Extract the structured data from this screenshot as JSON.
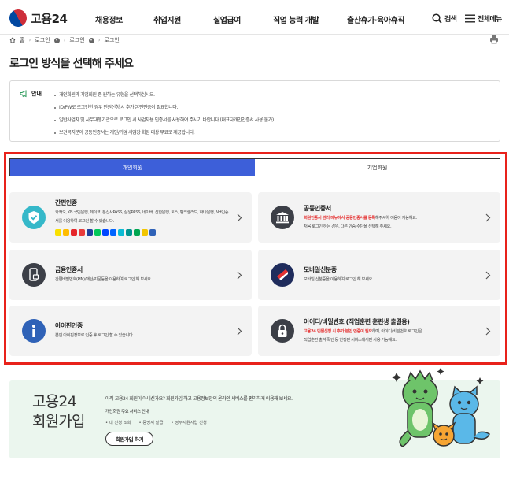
{
  "header": {
    "logo_text": "고용24",
    "nav": [
      "채용정보",
      "취업지원",
      "실업급여",
      "직업 능력 개발",
      "출산휴가·육아휴직"
    ],
    "search_label": "검색",
    "menu_label": "전체메뉴"
  },
  "breadcrumb": [
    "홈",
    "로그인",
    "로그인",
    "로그인"
  ],
  "page_title": "로그인 방식을 선택해 주세요",
  "notice": {
    "label": "안내",
    "items": [
      "개인회원과 기업회원 중 원하는 유형을 선택하십시오.",
      "ID/PW로 로그인한 경우 민원신청 시 추가 본인인증이 필요합니다.",
      "일반사업자 및 사무대행기관으로 로그인 시 사업자용 인증서를 사용하여 주시기 바랍니다.(대표자개인인증서 사용 불가)",
      "보건복지분야 공동인증서는 개인/기업 사업장 회원 대상 무료로 제공합니다."
    ]
  },
  "tabs": {
    "personal": "개인회원",
    "corporate": "기업회원"
  },
  "methods": {
    "simple": {
      "title": "간편인증",
      "desc": "카카오, KB 국민은행, 페이코, 통신사PASS, 삼성PASS, 네이버, 신한은행, 토스, 뱅크샐러드, 하나은행, NH인증서를 이용하여 로그인 할 수 있습니다."
    },
    "joint": {
      "title": "공동인증서",
      "desc_em": "회원인증서 관리 메뉴에서 공동인증서를 등록",
      "desc_rest": "해주셔야 이용이 가능해요.",
      "desc2": "처음 로그인 하는 경우, 다른 인증 수단을 선택해 주세요."
    },
    "financial": {
      "title": "금융인증서",
      "desc": "간편비밀번호(PIN)/패턴/지문등을 이용하여 로그인 해 보세요."
    },
    "mobile_id": {
      "title": "모바일신분증",
      "desc": "모바일 신분증을 이용하여 로그인 해 보세요."
    },
    "ipin": {
      "title": "아이핀인증",
      "desc": "본인 아이핀정보로 인증 후 로그인 할 수 있습니다."
    },
    "idpw": {
      "title": "아이디/비밀번호 (직업훈련 훈련생 출결용)",
      "desc_em": "고용24 민원신청 시 추가 본인 인증이 필요",
      "desc_rest": "하며, 아이디/비밀번호 로그인은",
      "desc2": "직업훈련 출석 확인 등 한정된 서비스에서만 사용 가능해요."
    }
  },
  "banner": {
    "title_line1": "고용24",
    "title_line2": "회원가입",
    "desc": "아직 고용24 회원이 아니신가요? 회원가입 하고 고용정보망의 온라인 서비스를 편리하게 이용해 보세요.",
    "sub": "개인회원 주요 서비스 안내",
    "services": [
      "내 신청 조회",
      "증명서 발급",
      "정부지원사업 신청"
    ],
    "join_button": "회원가입 하기"
  },
  "colors": {
    "accent": "#3d5fd9",
    "highlight": "#e8221b",
    "simple_icon": "#35b8c9",
    "card_bg": "#f3f3f3",
    "ipin_icon": "#2f62b7",
    "banner_bg": "#ebf6ee"
  },
  "icons": [
    "search-icon",
    "hamburger-menu-icon",
    "home-icon",
    "print-icon",
    "megaphone-icon",
    "shield-check-icon",
    "bank-icon",
    "phone-card-icon",
    "mobile-id-icon",
    "info-icon",
    "lock-icon",
    "chevron-right-icon"
  ]
}
